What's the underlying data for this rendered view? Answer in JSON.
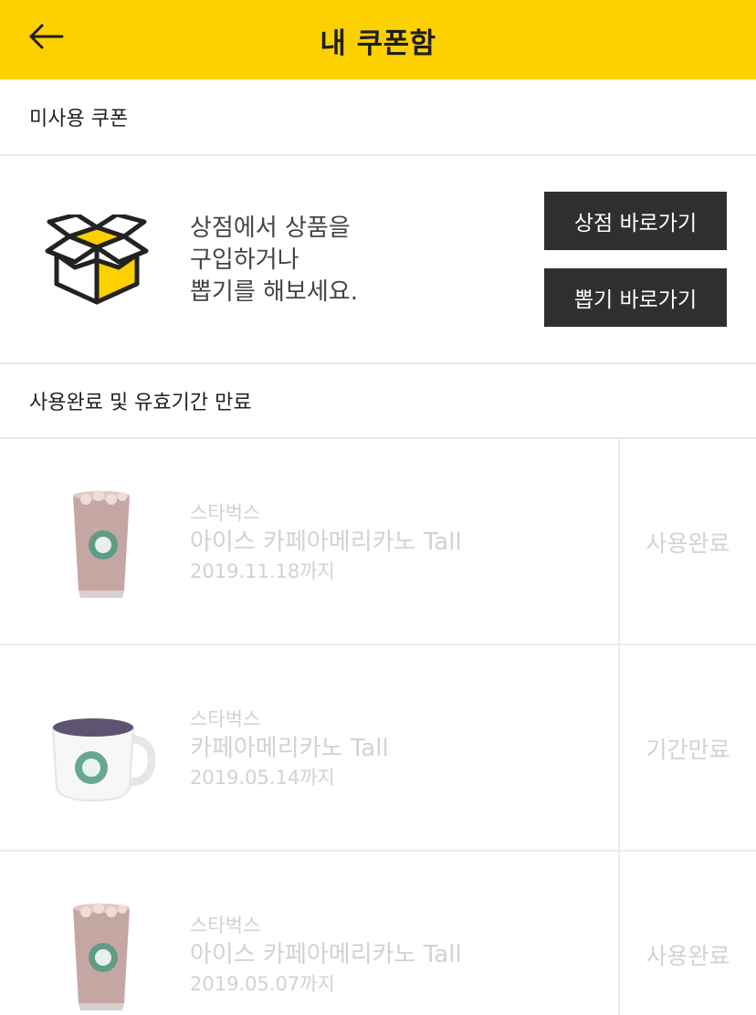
{
  "header": {
    "title": "내 쿠폰함",
    "back_icon": "arrow-left-icon",
    "background_color": "#fdd000"
  },
  "unused_section": {
    "title": "미사용 쿠폰",
    "empty_icon": "open-box-icon",
    "empty_message_lines": [
      "상점에서 상품을",
      "구입하거나",
      "뽑기를 해보세요."
    ],
    "shop_button_label": "상점 바로가기",
    "draw_button_label": "뽑기 바로가기"
  },
  "used_section": {
    "title": "사용완료 및 유효기간 만료",
    "coupons": [
      {
        "brand": "스타벅스",
        "product": "아이스 카페아메리카노 Tall",
        "expiry": "2019.11.18까지",
        "status": "사용완료",
        "image": "iced-americano-cup"
      },
      {
        "brand": "스타벅스",
        "product": "카페아메리카노 Tall",
        "expiry": "2019.05.14까지",
        "status": "기간만료",
        "image": "hot-americano-mug"
      },
      {
        "brand": "스타벅스",
        "product": "아이스 카페아메리카노 Tall",
        "expiry": "2019.05.07까지",
        "status": "사용완료",
        "image": "iced-americano-cup"
      }
    ]
  }
}
